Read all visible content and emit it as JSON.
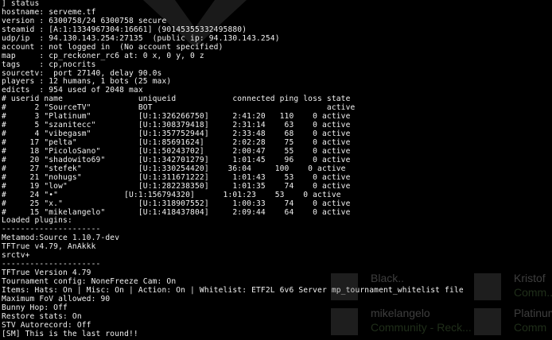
{
  "console": {
    "lines": [
      "] status",
      "hostname: serveme.tf",
      "version : 6300758/24 6300758 secure",
      "steamid : [A:1:1334967304:16661] (90145355332495880)",
      "udp/ip  : 94.130.143.254:27135  (public ip: 94.130.143.254)",
      "account : not logged in  (No account specified)",
      "map     : cp_reckoner_rc6 at: 0 x, 0 y, 0 z",
      "tags    : cp,nocrits",
      "sourcetv:  port 27140, delay 90.0s",
      "players : 12 humans, 1 bots (25 max)",
      "edicts  : 954 used of 2048 max",
      "# userid name                uniqueid            connected ping loss state",
      "#      2 \"SourceTV\"          BOT                                     active",
      "#      3 \"Platinum\"          [U:1:326266750]     2:41:20   110    0 active",
      "#      5 \"szanitecc\"         [U:1:308379418]     2:31:14    63    0 active",
      "#      4 \"vibegasm\"          [U:1:357752944]     2:33:48    68    0 active",
      "#     17 \"pelta\"             [U:1:85691624]      2:02:28    75    0 active",
      "#     18 \"PicoloSano\"        [U:1:50243702]      2:00:47    55    0 active",
      "#     20 \"shadowito69\"       [U:1:342701279]     1:01:45    96    0 active",
      "#     27 \"stefek\"            [U:1:330254420]    36:04     100    0 active",
      "#     21 \"nohugs\"            [U:1:311671222]     1:01:43    53    0 active",
      "#     19 \"low\"               [U:1:282238350]     1:01:35    74    0 active",
      "#     24 \"•\"              [U:1:156794320]      1:01:23    53    0 active",
      "#     25 \"x.\"                [U:1:318907552]     1:00:33    74    0 active",
      "#     15 \"mikelangelo\"       [U:1:418437804]     2:09:44    64    0 active",
      "Loaded plugins:",
      "---------------------",
      "Metamod:Source 1.10.7-dev",
      "TFTrue v4.79, AnAkkk",
      "srctv+",
      "---------------------",
      "TFTrue Version 4.79",
      "Tournament config: NoneFreeze Cam: On",
      "Items: Hats: On | Misc: On | Action: On | Whitelist: ETF2L 6v6 Server mp_tournament_whitelist file",
      "Maximum FoV allowed: 90",
      "Bunny Hop: Off",
      "Restore stats: On",
      "STV Autorecord: Off",
      "[SM] This is the last round!!"
    ]
  },
  "friends": [
    {
      "name": "Black..",
      "status": ""
    },
    {
      "name": "Kristof",
      "status": "Comm..."
    },
    {
      "name": "mikelangelo",
      "status": "Community - Reck..."
    },
    {
      "name": "Platinum",
      "status": "Comm"
    }
  ],
  "colors": {
    "background": "#000000",
    "text": "#f2f2f2",
    "friend_status": "#6fa35b"
  }
}
